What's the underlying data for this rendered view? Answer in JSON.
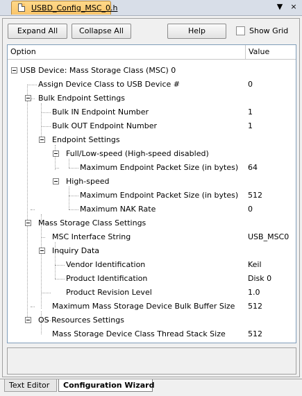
{
  "file_tab": {
    "title": "USBD_Config_MSC_0.h",
    "controls": {
      "dropdown": "▼",
      "close": "×"
    }
  },
  "toolbar": {
    "expand_all": "Expand All",
    "collapse_all": "Collapse All",
    "help": "Help",
    "show_grid_label": "Show Grid",
    "show_grid_checked": false
  },
  "tree": {
    "columns": {
      "option": "Option",
      "value": "Value"
    },
    "rows": [
      {
        "label": "USB Device: Mass Storage Class (MSC) 0",
        "value": ""
      },
      {
        "label": "Assign Device Class to USB Device #",
        "value": "0"
      },
      {
        "label": "Bulk Endpoint Settings",
        "value": ""
      },
      {
        "label": "Bulk IN Endpoint Number",
        "value": "1"
      },
      {
        "label": "Bulk OUT Endpoint Number",
        "value": "1"
      },
      {
        "label": "Endpoint Settings",
        "value": ""
      },
      {
        "label": "Full/Low-speed (High-speed disabled)",
        "value": ""
      },
      {
        "label": "Maximum Endpoint Packet Size (in bytes)",
        "value": "64"
      },
      {
        "label": "High-speed",
        "value": ""
      },
      {
        "label": "Maximum Endpoint Packet Size (in bytes)",
        "value": "512"
      },
      {
        "label": "Maximum NAK Rate",
        "value": "0"
      },
      {
        "label": "Mass Storage Class Settings",
        "value": ""
      },
      {
        "label": "MSC Interface String",
        "value": "USB_MSC0"
      },
      {
        "label": "Inquiry Data",
        "value": ""
      },
      {
        "label": "Vendor Identification",
        "value": "Keil"
      },
      {
        "label": "Product Identification",
        "value": "Disk 0"
      },
      {
        "label": "Product Revision Level",
        "value": "1.0"
      },
      {
        "label": "Maximum Mass Storage Device Bulk Buffer Size",
        "value": "512"
      },
      {
        "label": "OS Resources Settings",
        "value": ""
      },
      {
        "label": "Mass Storage Device Class Thread Stack Size",
        "value": "512"
      }
    ]
  },
  "bottom_tabs": {
    "text_editor": "Text Editor",
    "configuration_wizard": "Configuration Wizard"
  }
}
